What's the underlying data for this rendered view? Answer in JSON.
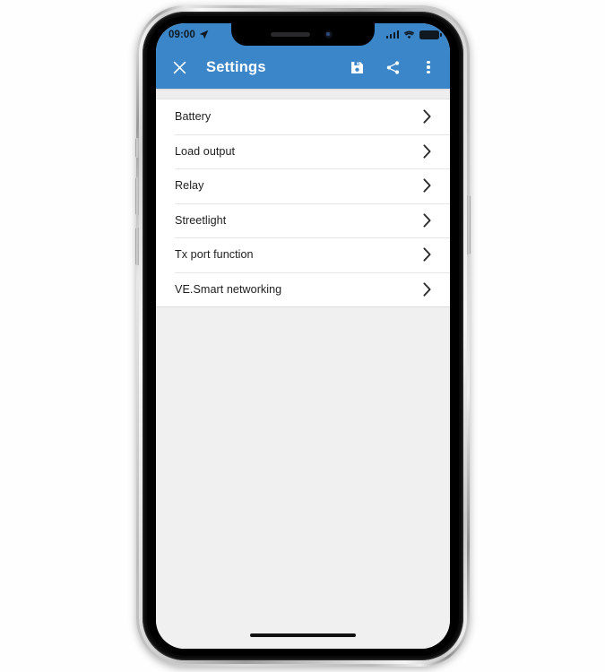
{
  "device": {
    "type": "smartphone-mockup",
    "frame_color": "#c9c9c9",
    "bezel_color": "#000000"
  },
  "status_bar": {
    "time": "09:00",
    "location_icon": "location-arrow-icon",
    "signal_icon": "cellular-signal-icon",
    "wifi_icon": "wifi-icon",
    "battery_icon": "battery-full-icon",
    "background_color": "#3b86c9",
    "icon_color": "#101820"
  },
  "app_bar": {
    "close_icon": "close-x-icon",
    "title": "Settings",
    "save_icon": "save-floppy-icon",
    "share_icon": "share-icon",
    "overflow_icon": "more-vertical-icon",
    "background_color": "#3b86c9",
    "text_color": "#ffffff"
  },
  "content": {
    "background_color": "#f0f0f0",
    "card_background": "#ffffff",
    "chevron_icon": "chevron-right-icon",
    "items": [
      {
        "label": "Battery"
      },
      {
        "label": "Load output"
      },
      {
        "label": "Relay"
      },
      {
        "label": "Streetlight"
      },
      {
        "label": "Tx port function"
      },
      {
        "label": "VE.Smart networking"
      }
    ]
  },
  "home_indicator": {
    "name": "home-indicator-bar"
  }
}
